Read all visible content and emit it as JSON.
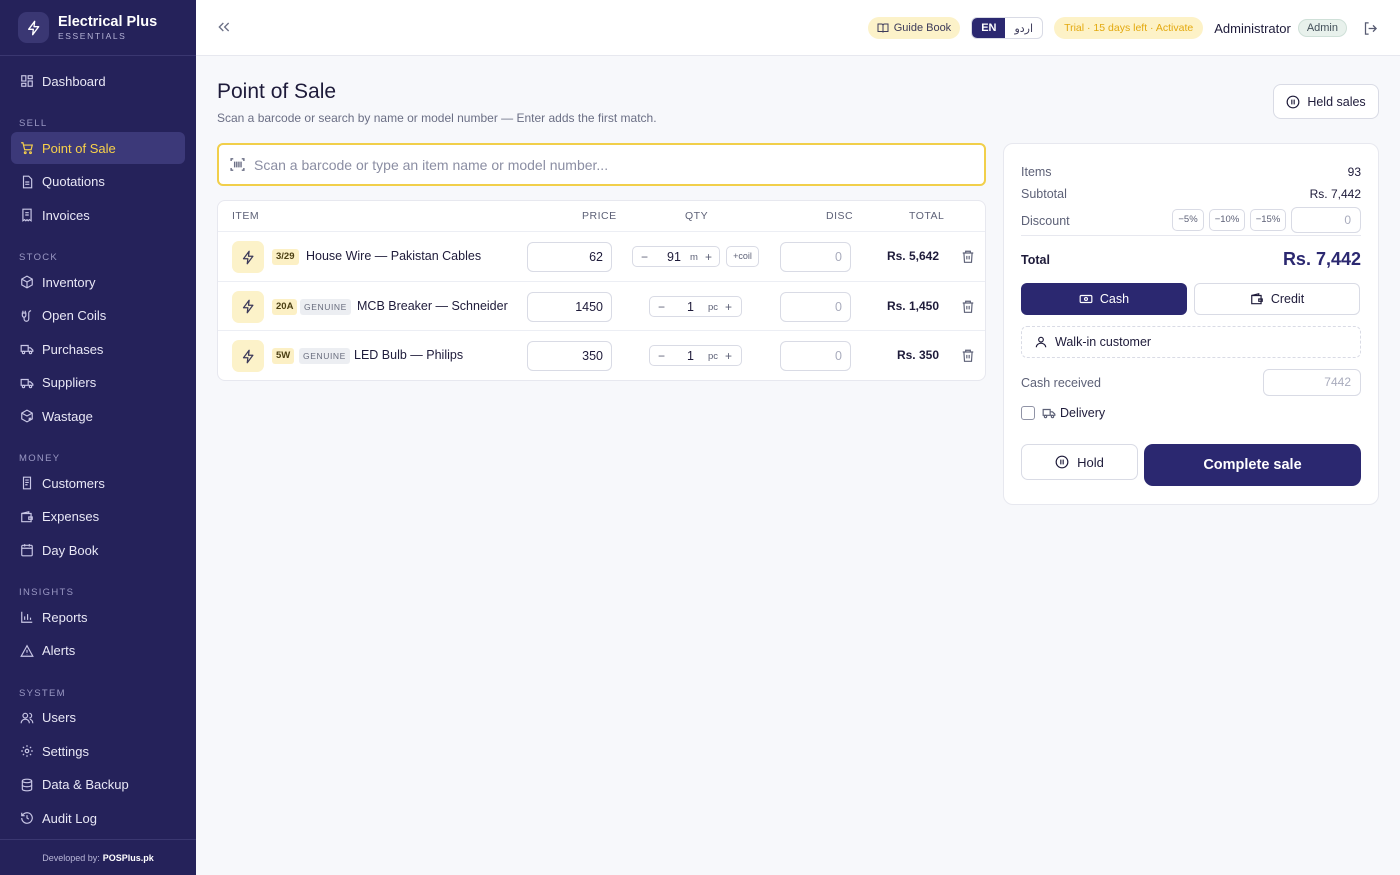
{
  "brand": {
    "name": "Electrical Plus",
    "sub": "ESSENTIALS"
  },
  "nav": {
    "dashboard": "Dashboard",
    "sections": {
      "sell": "SELL",
      "stock": "STOCK",
      "money": "MONEY",
      "insights": "INSIGHTS",
      "system": "SYSTEM"
    },
    "sell": [
      "Point of Sale",
      "Quotations",
      "Invoices"
    ],
    "stock": [
      "Inventory",
      "Open Coils",
      "Purchases",
      "Suppliers",
      "Wastage"
    ],
    "money": [
      "Customers",
      "Expenses",
      "Day Book"
    ],
    "insights": [
      "Reports",
      "Alerts"
    ],
    "system": [
      "Users",
      "Settings",
      "Data & Backup",
      "Audit Log"
    ]
  },
  "footer": {
    "prefix": "Developed by:",
    "name": "POSPlus.pk"
  },
  "topbar": {
    "guide": "Guide Book",
    "lang_en": "EN",
    "lang_ur": "اردو",
    "trial": "Trial · 15 days left · Activate",
    "user": "Administrator",
    "role": "Admin"
  },
  "page": {
    "title": "Point of Sale",
    "subtitle": "Scan a barcode or search by name or model number — Enter adds the first match.",
    "held_sales": "Held sales",
    "search_placeholder": "Scan a barcode or type an item name or model number..."
  },
  "cart": {
    "headers": {
      "item": "ITEM",
      "price": "PRICE",
      "qty": "QTY",
      "disc": "DISC",
      "total": "TOTAL"
    },
    "rows": [
      {
        "size": "3/29",
        "name": "House Wire — Pakistan Cables",
        "price": "62",
        "qty": "91",
        "unit": "m",
        "coil": "+coil",
        "disc": "0",
        "total": "Rs. 5,642"
      },
      {
        "size": "20A",
        "genuine": "GENUINE",
        "name": "MCB Breaker — Schneider",
        "price": "1450",
        "qty": "1",
        "unit": "pc",
        "disc": "0",
        "total": "Rs. 1,450"
      },
      {
        "size": "5W",
        "genuine": "GENUINE",
        "name": "LED Bulb — Philips",
        "price": "350",
        "qty": "1",
        "unit": "pc",
        "disc": "0",
        "total": "Rs. 350"
      }
    ]
  },
  "summary": {
    "items_label": "Items",
    "items": "93",
    "subtotal_label": "Subtotal",
    "subtotal": "Rs. 7,442",
    "discount_label": "Discount",
    "chips": [
      "−5%",
      "−10%",
      "−15%"
    ],
    "discount": "0",
    "total_label": "Total",
    "total": "Rs. 7,442",
    "cash": "Cash",
    "credit": "Credit",
    "customer": "Walk-in customer",
    "cash_received_label": "Cash received",
    "cash_received": "7442",
    "delivery": "Delivery",
    "hold": "Hold",
    "complete": "Complete sale"
  },
  "colors": {
    "sidebar": "#25225a",
    "accent": "#2b2870",
    "highlight": "#f8d14a"
  }
}
